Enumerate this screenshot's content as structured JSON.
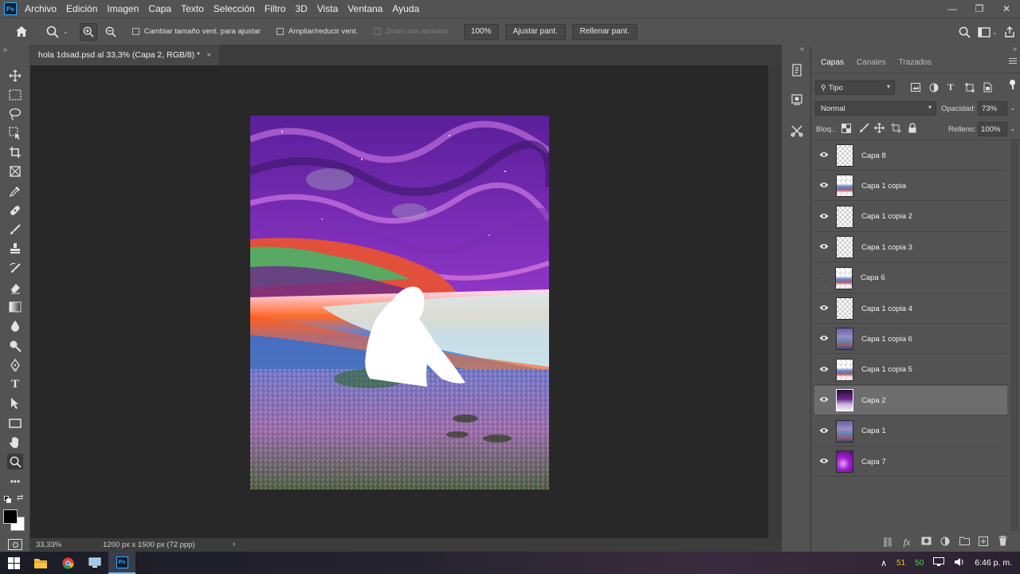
{
  "app": {
    "logo": "Ps"
  },
  "menu": [
    "Archivo",
    "Edición",
    "Imagen",
    "Capa",
    "Texto",
    "Selección",
    "Filtro",
    "3D",
    "Vista",
    "Ventana",
    "Ayuda"
  ],
  "window_controls": {
    "minimize": "—",
    "restore": "❐",
    "close": "✕"
  },
  "options_bar": {
    "resize_windows_label": "Cambiar tamaño vent. para ajustar",
    "zoom_all_label": "Ampliar/reducir vent.",
    "scrubby_zoom_label": "Zoom con arrastre",
    "zoom_value": "100%",
    "fit_screen_label": "Ajustar pant.",
    "fill_screen_label": "Rellenar pant."
  },
  "document": {
    "tab_title": "hola 1dsad.psd al 33,3% (Capa 2, RGB/8) *",
    "close_glyph": "×",
    "zoom": "33,33%",
    "size_info": "1200 px x 1500 px (72 ppp)"
  },
  "panel": {
    "tabs": [
      "Capas",
      "Canales",
      "Trazados"
    ],
    "active_tab": "Capas",
    "filter_kind": "Tipo",
    "blend_mode": "Normal",
    "opacity_label": "Opacidad:",
    "opacity_value": "73%",
    "lock_label": "Bloq.:",
    "fill_label": "Relleno:",
    "fill_value": "100%",
    "layers": [
      {
        "name": "Capa 8",
        "visible": true,
        "thumb": "empty"
      },
      {
        "name": "Capa 1 copia",
        "visible": true,
        "thumb": "mixed"
      },
      {
        "name": "Capa 1 copia 2",
        "visible": true,
        "thumb": "empty"
      },
      {
        "name": "Capa 1 copia 3",
        "visible": true,
        "thumb": "empty"
      },
      {
        "name": "Capa 6",
        "visible": false,
        "thumb": "mixed"
      },
      {
        "name": "Capa 1 copia 4",
        "visible": true,
        "thumb": "empty"
      },
      {
        "name": "Capa 1 copia 6",
        "visible": true,
        "thumb": "photo"
      },
      {
        "name": "Capa 1 copia 5",
        "visible": true,
        "thumb": "mixed"
      },
      {
        "name": "Capa 2",
        "visible": true,
        "thumb": "dark",
        "selected": true
      },
      {
        "name": "Capa 1",
        "visible": true,
        "thumb": "photo"
      },
      {
        "name": "Capa 7",
        "visible": true,
        "thumb": "purple"
      }
    ]
  },
  "taskbar": {
    "tray_numbers": [
      "51",
      "50"
    ],
    "clock": "6:46 p. m."
  },
  "colors": {
    "ui_dark": "#535353",
    "canvas_bg": "#282828",
    "selected_layer": "#6d6d6d",
    "ps_blue": "#31a8ff"
  }
}
